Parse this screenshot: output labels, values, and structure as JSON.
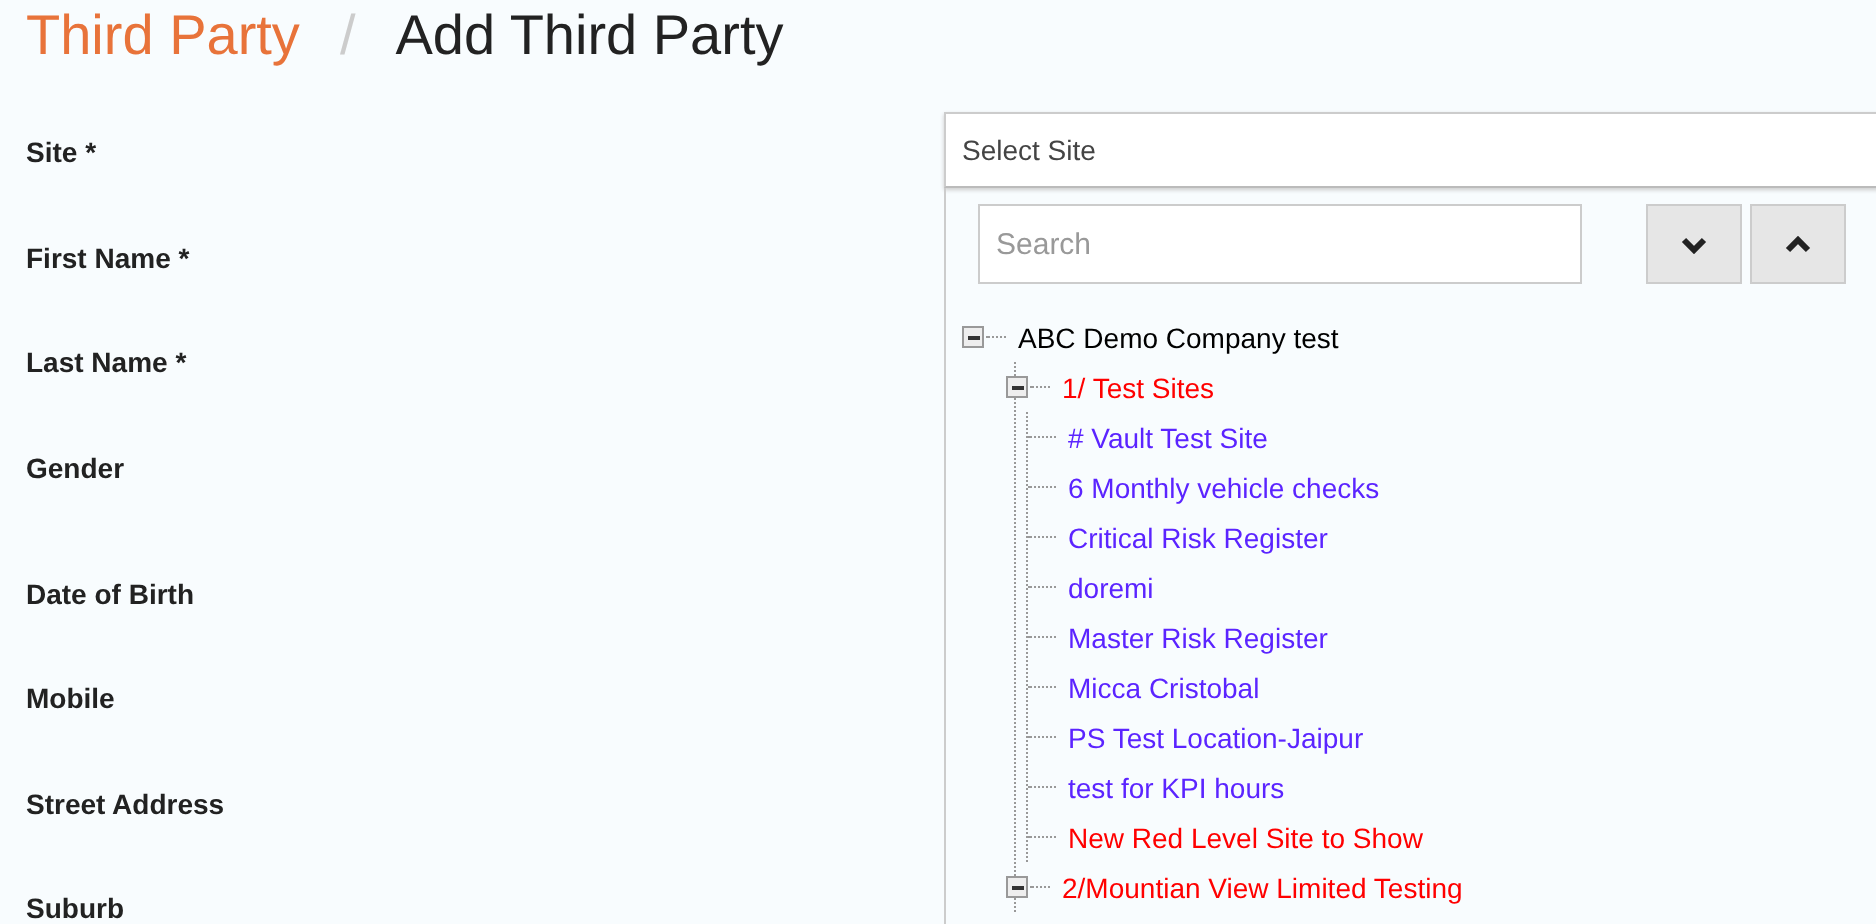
{
  "breadcrumb": {
    "parent": "Third Party",
    "separator": "/",
    "current": "Add Third Party"
  },
  "form_labels": [
    "Site *",
    "First Name *",
    "Last Name *",
    "Gender",
    "Date of Birth",
    "Mobile",
    "Street Address",
    "Suburb"
  ],
  "site_select": {
    "placeholder": "Select Site",
    "expanded": true
  },
  "dropdown": {
    "search": {
      "placeholder": "Search"
    },
    "tree": [
      {
        "label": "ABC Demo Company test",
        "color": "#000000",
        "expanded": true,
        "children": [
          {
            "label": "1/ Test Sites",
            "color": "#ff0000",
            "expanded": true,
            "children": [
              {
                "label": "# Vault Test Site",
                "color": "#5b24ff"
              },
              {
                "label": "6 Monthly vehicle checks",
                "color": "#5b24ff"
              },
              {
                "label": "Critical Risk Register",
                "color": "#5b24ff"
              },
              {
                "label": "doremi",
                "color": "#5b24ff"
              },
              {
                "label": "Master Risk Register",
                "color": "#5b24ff"
              },
              {
                "label": "Micca Cristobal",
                "color": "#5b24ff"
              },
              {
                "label": "PS Test Location-Jaipur",
                "color": "#5b24ff"
              },
              {
                "label": "test for KPI hours",
                "color": "#5b24ff"
              },
              {
                "label": "New Red Level Site to Show",
                "color": "#ff0000"
              }
            ]
          },
          {
            "label": "2/Mountian View Limited Testing",
            "color": "#ff0000",
            "expanded": true
          }
        ]
      }
    ]
  }
}
